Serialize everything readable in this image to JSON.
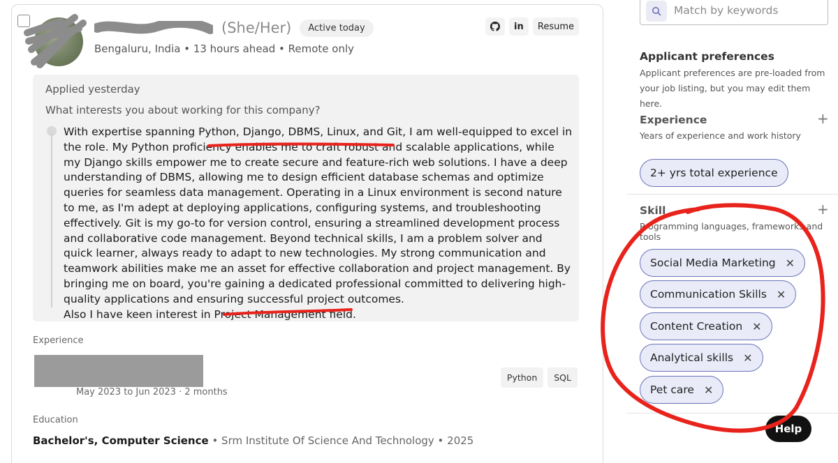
{
  "candidate": {
    "pronouns": "(She/Her)",
    "status": "Active today",
    "location": "Bengaluru, India • 13 hours ahead • Remote only",
    "actions": {
      "github_icon": "github-icon",
      "linkedin_label": "in",
      "resume_label": "Resume"
    }
  },
  "application": {
    "applied": "Applied yesterday",
    "question": "What interests you about working for this company?",
    "answer_part1": "With expertise spanning Python, Django, DBMS, Linux, and Git, I am well-equipped to excel in the role. My Python proficiency enables me to craft robust and scalable applications, while my Django skills empower me to create secure and feature-rich web solutions. I have a deep understanding of DBMS, allowing me to design efficient database schemas and optimize queries for seamless data management. Operating in a Linux environment is second nature to me, as I'm adept at deploying applications, configuring systems, and troubleshooting effectively. Git is my go-to for version control, ensuring a streamlined development process and collaborative code management. Beyond technical skills, I am a problem solver and quick learner, always ready to adapt to new technologies. My strong communication and teamwork abilities make me an asset for effective collaboration and project management. By bringing me on board, you're gaining a dedicated professional committed to delivering high-quality applications and ensuring successful project outcomes.",
    "answer_part2": "Also I have keen interest in Project Management field."
  },
  "experience": {
    "label": "Experience",
    "dates": "May 2023 to Jun 2023 · 2 months",
    "tags": [
      "Python",
      "SQL"
    ]
  },
  "education": {
    "label": "Education",
    "degree": "Bachelor's, Computer Science",
    "details": " • Srm Institute Of Science And Technology • 2025"
  },
  "sidebar": {
    "search_placeholder": "Match by keywords",
    "preferences_title": "Applicant preferences",
    "preferences_desc": "Applicant preferences are pre-loaded from your job listing, but you may edit them here.",
    "experience_title": "Experience",
    "experience_desc": "Years of experience and work history",
    "experience_chip": "2+ yrs total experience",
    "skill_title": "Skill",
    "skill_desc": "Programming languages, frameworks and tools",
    "skills": [
      "Social Media Marketing",
      "Communication Skills",
      "Content Creation",
      "Analytical skills",
      "Pet care"
    ],
    "help_label": "Help"
  },
  "colors": {
    "chip_border": "#6b73b8",
    "chip_bg": "#e9ebf8",
    "annotation_red": "#e8231c"
  }
}
